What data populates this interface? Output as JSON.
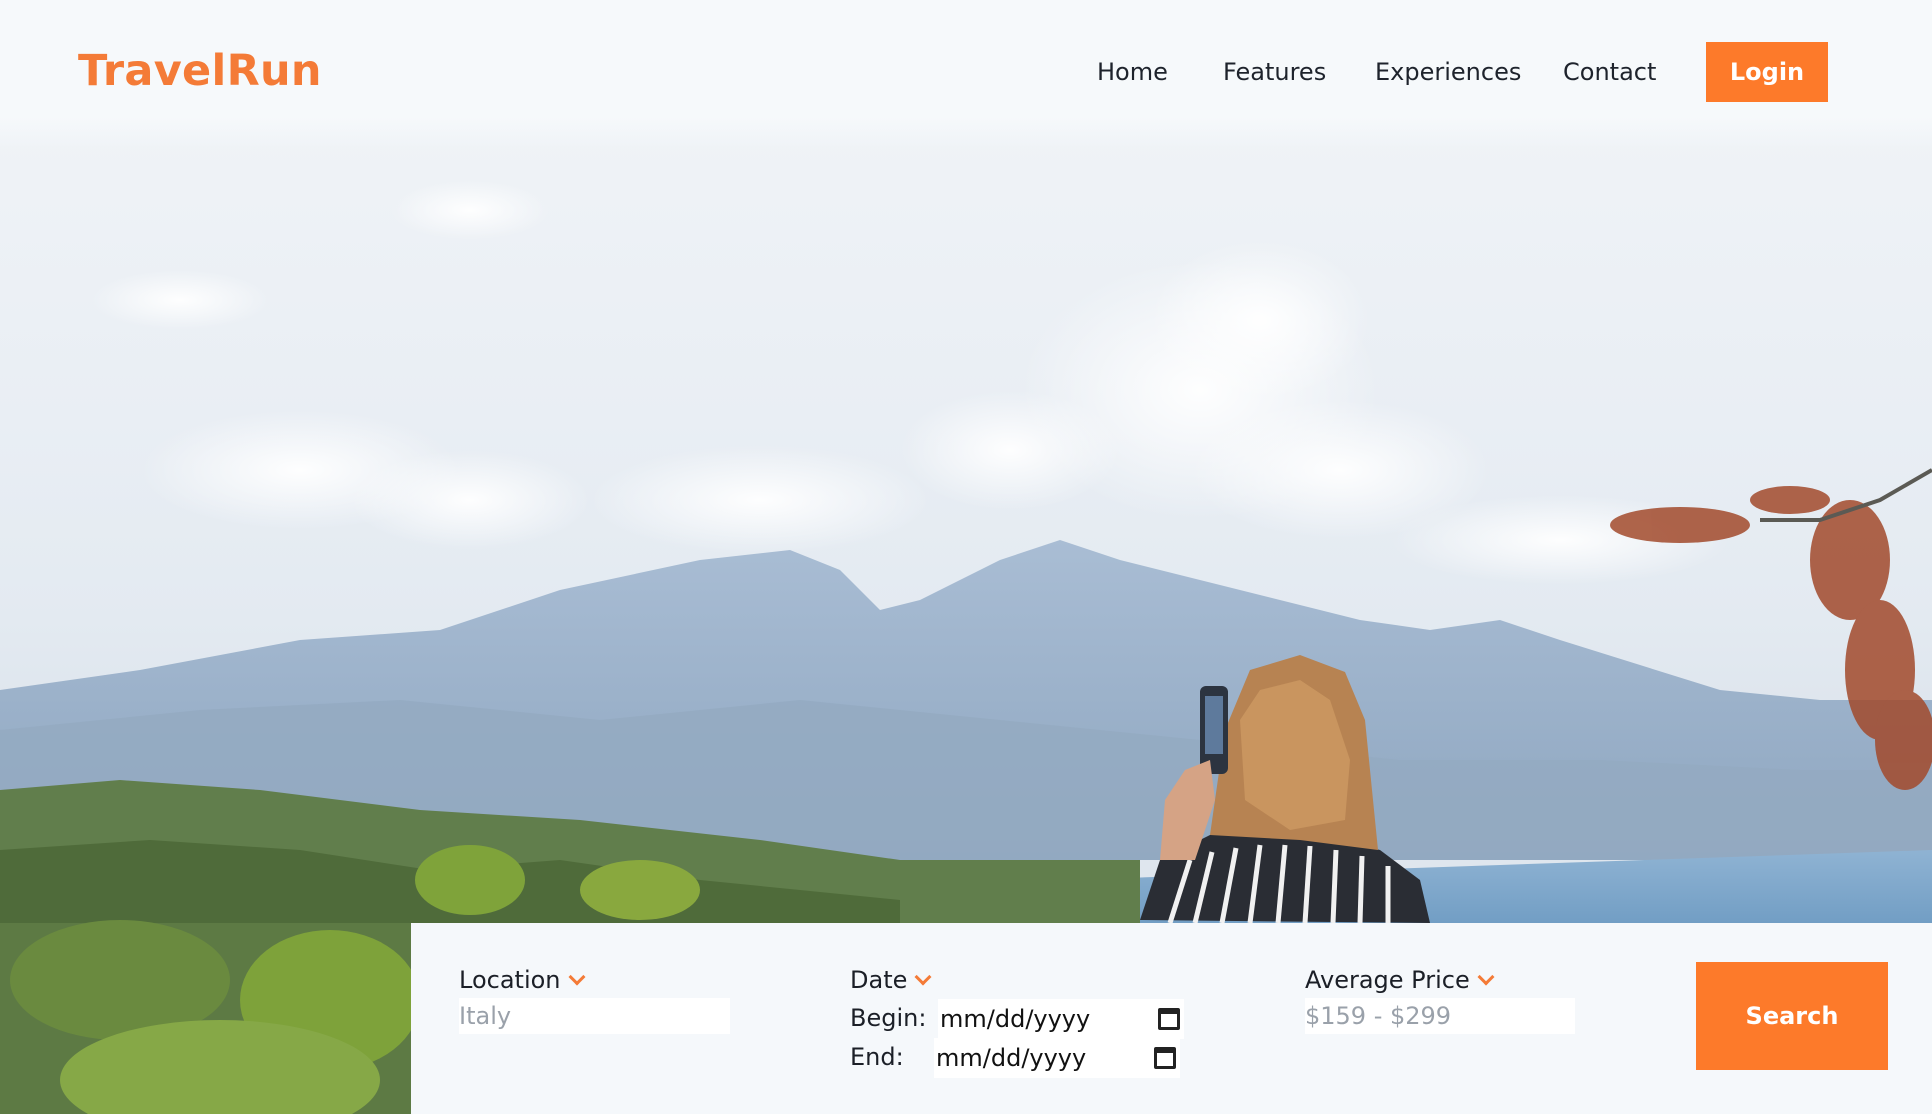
{
  "brand": {
    "name": "TravelRun",
    "accent": "#f47b37",
    "button": "#fd7a2a"
  },
  "nav": {
    "items": [
      "Home",
      "Features",
      "Experiences",
      "Contact"
    ],
    "login_label": "Login"
  },
  "search": {
    "location": {
      "label": "Location",
      "placeholder": "Italy"
    },
    "date": {
      "label": "Date",
      "begin_label": "Begin:",
      "end_label": "End:",
      "begin_value": "mm/dd/yyyy",
      "end_value": "mm/dd/yyyy"
    },
    "price": {
      "label": "Average Price",
      "placeholder": "$159 - $299"
    },
    "button_label": "Search"
  },
  "icons": {
    "dropdown": "chevron-down-icon",
    "calendar": "calendar-icon"
  }
}
